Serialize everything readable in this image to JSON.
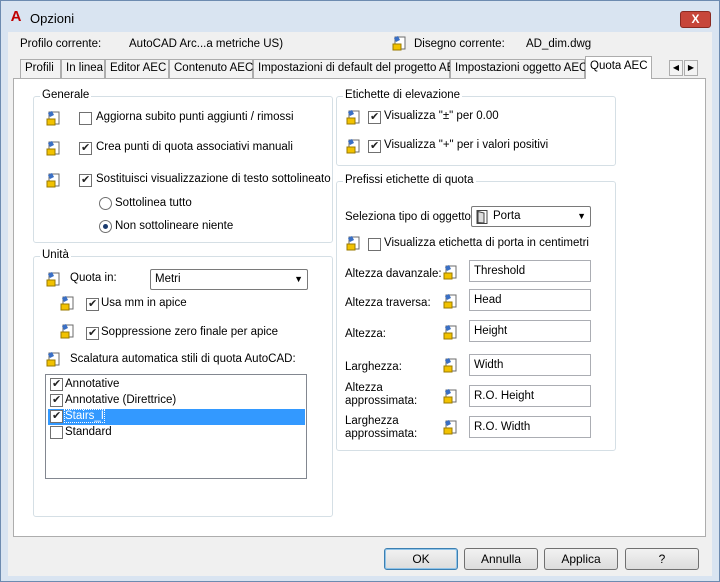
{
  "window": {
    "title": "Opzioni",
    "close_label": "X"
  },
  "header": {
    "profile_label": "Profilo corrente:",
    "profile_value": "AutoCAD Arc...a metriche US)",
    "drawing_label": "Disegno corrente:",
    "drawing_value": "AD_dim.dwg"
  },
  "tabs": [
    "Profili",
    "In linea",
    "Editor AEC",
    "Contenuto AEC",
    "Impostazioni di default del progetto AEC",
    "Impostazioni oggetto AEC",
    "Quota AEC"
  ],
  "active_tab": "Quota AEC",
  "generale": {
    "title": "Generale",
    "opt1": {
      "label": "Aggiorna subito punti aggiunti / rimossi",
      "checked": false
    },
    "opt2": {
      "label": "Crea punti di quota associativi manuali",
      "checked": true
    },
    "opt3": {
      "label": "Sostituisci visualizzazione di testo sottolineato",
      "checked": true
    },
    "radio1": {
      "label": "Sottolinea tutto",
      "selected": false
    },
    "radio2": {
      "label": "Non sottolineare niente",
      "selected": true
    }
  },
  "unita": {
    "title": "Unità",
    "quota_label": "Quota in:",
    "quota_value": "Metri",
    "mm_apice": {
      "label": "Usa mm in apice",
      "checked": true
    },
    "soppressione": {
      "label": "Soppressione zero finale per apice",
      "checked": true
    },
    "scalatura_label": "Scalatura automatica stili di quota AutoCAD:",
    "styles": [
      {
        "label": "Annotative",
        "checked": true
      },
      {
        "label": "Annotative (Direttrice)",
        "checked": true
      },
      {
        "label": "Stairs_I",
        "checked": true
      },
      {
        "label": "Standard",
        "checked": false
      }
    ]
  },
  "etichette": {
    "title": "Etichette di elevazione",
    "opt1": {
      "label": "Visualizza \"±\" per 0.00",
      "checked": true
    },
    "opt2": {
      "label": "Visualizza \"+\" per i valori positivi",
      "checked": true
    }
  },
  "prefissi": {
    "title": "Prefissi etichette di quota",
    "tipo_label": "Seleziona tipo di oggetto:",
    "tipo_value": "Porta",
    "centimetri": {
      "label": "Visualizza etichetta di porta in centimetri",
      "checked": false
    },
    "fields": [
      {
        "label": "Altezza davanzale:",
        "value": "Threshold"
      },
      {
        "label": "Altezza traversa:",
        "value": "Head"
      },
      {
        "label": "Altezza:",
        "value": "Height"
      },
      {
        "label": "Larghezza:",
        "value": "Width"
      },
      {
        "label": "Altezza approssimata:",
        "value": "R.O. Height"
      },
      {
        "label": "Larghezza approssimata:",
        "value": "R.O. Width"
      }
    ]
  },
  "buttons": {
    "ok": "OK",
    "cancel": "Annulla",
    "apply": "Applica",
    "help": "?"
  },
  "colors": {
    "selection": "#3399ff",
    "window_frame": "#d9e4f1",
    "close": "#c7463a"
  }
}
